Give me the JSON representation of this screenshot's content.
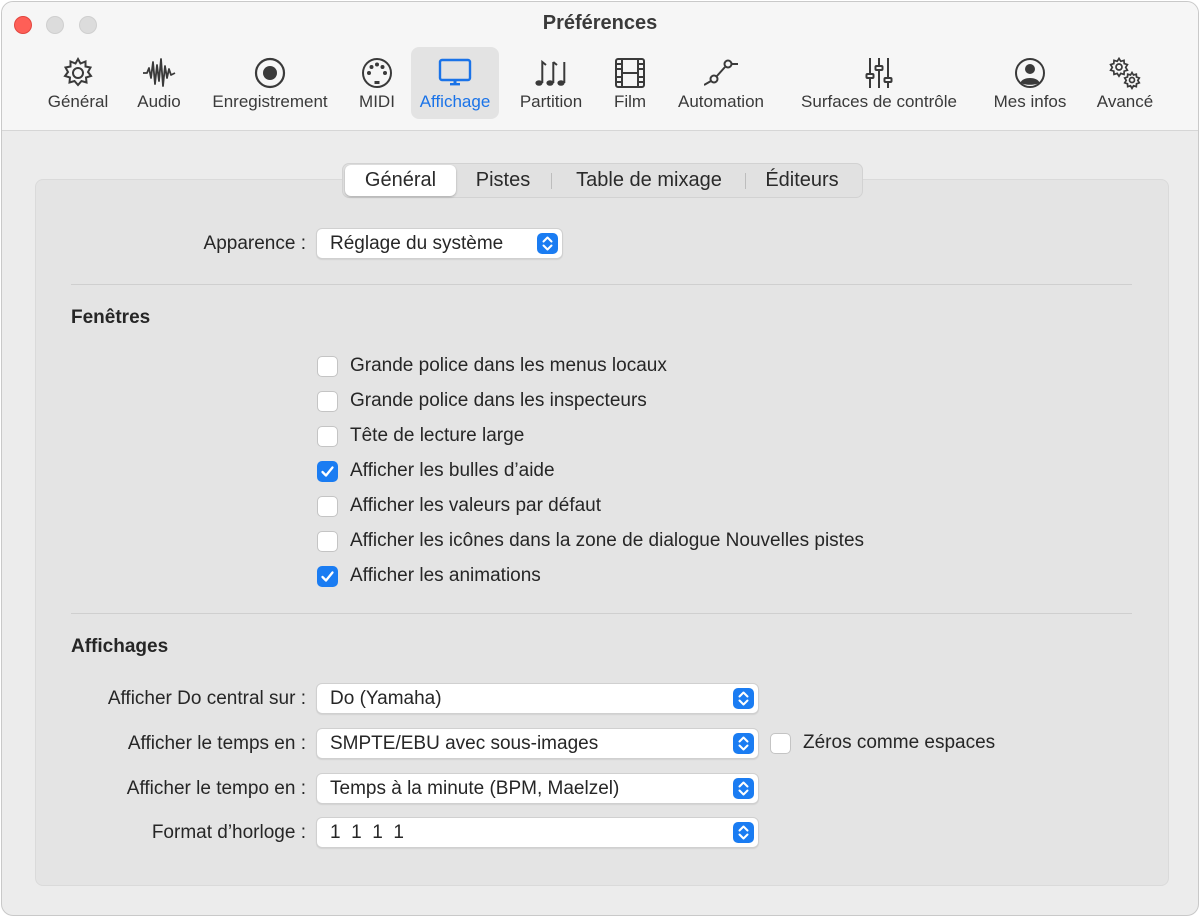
{
  "window": {
    "title": "Préférences"
  },
  "toolbar": {
    "items": [
      {
        "label": "Général",
        "icon": "gear-icon"
      },
      {
        "label": "Audio",
        "icon": "waveform-icon"
      },
      {
        "label": "Enregistrement",
        "icon": "record-icon"
      },
      {
        "label": "MIDI",
        "icon": "midi-connector-icon"
      },
      {
        "label": "Affichage",
        "icon": "display-icon",
        "selected": true
      },
      {
        "label": "Partition",
        "icon": "music-notes-icon"
      },
      {
        "label": "Film",
        "icon": "film-icon"
      },
      {
        "label": "Automation",
        "icon": "automation-curve-icon"
      },
      {
        "label": "Surfaces de contrôle",
        "icon": "sliders-icon"
      },
      {
        "label": "Mes infos",
        "icon": "person-icon"
      },
      {
        "label": "Avancé",
        "icon": "gears-icon"
      }
    ],
    "accent_color": "#1a73e8"
  },
  "tabs": [
    {
      "label": "Général",
      "selected": true
    },
    {
      "label": "Pistes"
    },
    {
      "label": "Table de mixage"
    },
    {
      "label": "Éditeurs"
    }
  ],
  "appearance": {
    "label": "Apparence :",
    "value": "Réglage du système"
  },
  "windows_section": {
    "title": "Fenêtres",
    "options": [
      {
        "label": "Grande police dans les menus locaux",
        "checked": false
      },
      {
        "label": "Grande police dans les inspecteurs",
        "checked": false
      },
      {
        "label": "Tête de lecture large",
        "checked": false
      },
      {
        "label": "Afficher les bulles d’aide",
        "checked": true
      },
      {
        "label": "Afficher les valeurs par défaut",
        "checked": false
      },
      {
        "label": "Afficher les icônes dans la zone de dialogue Nouvelles pistes",
        "checked": false
      },
      {
        "label": "Afficher les animations",
        "checked": true
      }
    ]
  },
  "displays_section": {
    "title": "Affichages",
    "middle_c": {
      "label": "Afficher Do central sur :",
      "value": "Do (Yamaha)"
    },
    "time": {
      "label": "Afficher le temps en :",
      "value": "SMPTE/EBU avec sous-images"
    },
    "zeros": {
      "label": "Zéros comme espaces",
      "checked": false
    },
    "tempo": {
      "label": "Afficher le tempo en :",
      "value": "Temps à la minute (BPM, Maelzel)"
    },
    "clock": {
      "label": "Format d’horloge :",
      "value": "1  1  1  1"
    }
  },
  "colors": {
    "checkbox_checked": "#1a7cf2",
    "close_button": "#fe5f57"
  }
}
